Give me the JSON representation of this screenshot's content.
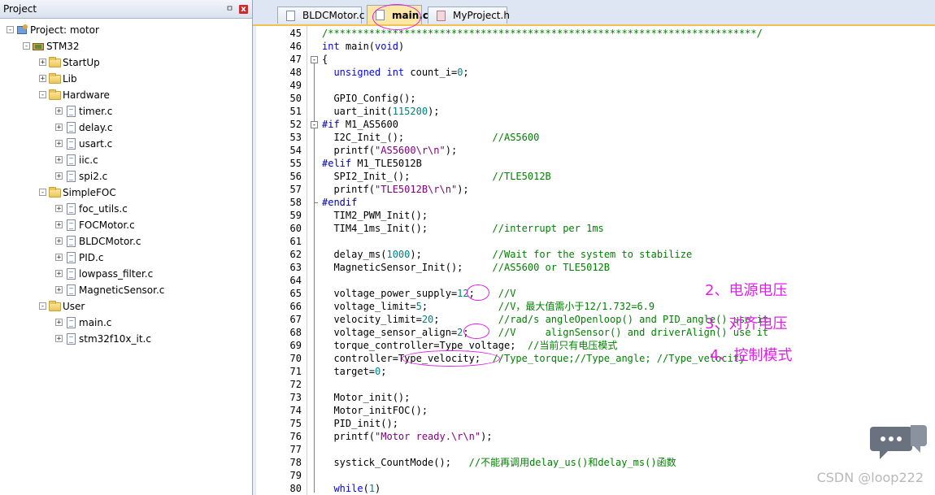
{
  "project_pane": {
    "title": "Project",
    "pin_glyph": "ㅁ",
    "close_glyph": "x",
    "tree": [
      {
        "label": "Project: motor",
        "level": 0,
        "icon": "project-icon",
        "expander": "-"
      },
      {
        "label": "STM32",
        "level": 1,
        "icon": "target-icon",
        "expander": "-"
      },
      {
        "label": "StartUp",
        "level": 2,
        "icon": "folder-icon",
        "expander": "+"
      },
      {
        "label": "Lib",
        "level": 2,
        "icon": "folder-icon",
        "expander": "+"
      },
      {
        "label": "Hardware",
        "level": 2,
        "icon": "folder-icon",
        "expander": "-"
      },
      {
        "label": "timer.c",
        "level": 3,
        "icon": "file-icon",
        "expander": "+"
      },
      {
        "label": "delay.c",
        "level": 3,
        "icon": "file-icon",
        "expander": "+"
      },
      {
        "label": "usart.c",
        "level": 3,
        "icon": "file-icon",
        "expander": "+"
      },
      {
        "label": "iic.c",
        "level": 3,
        "icon": "file-icon",
        "expander": "+"
      },
      {
        "label": "spi2.c",
        "level": 3,
        "icon": "file-icon",
        "expander": "+"
      },
      {
        "label": "SimpleFOC",
        "level": 2,
        "icon": "folder-icon",
        "expander": "-"
      },
      {
        "label": "foc_utils.c",
        "level": 3,
        "icon": "file-icon",
        "expander": "+"
      },
      {
        "label": "FOCMotor.c",
        "level": 3,
        "icon": "file-icon",
        "expander": "+"
      },
      {
        "label": "BLDCMotor.c",
        "level": 3,
        "icon": "file-icon",
        "expander": "+"
      },
      {
        "label": "PID.c",
        "level": 3,
        "icon": "file-icon",
        "expander": "+"
      },
      {
        "label": "lowpass_filter.c",
        "level": 3,
        "icon": "file-icon",
        "expander": "+"
      },
      {
        "label": "MagneticSensor.c",
        "level": 3,
        "icon": "file-icon",
        "expander": "+"
      },
      {
        "label": "User",
        "level": 2,
        "icon": "folder-icon",
        "expander": "-"
      },
      {
        "label": "main.c",
        "level": 3,
        "icon": "file-icon",
        "expander": "+"
      },
      {
        "label": "stm32f10x_it.c",
        "level": 3,
        "icon": "file-icon",
        "expander": "+"
      }
    ]
  },
  "tabs": [
    {
      "label": "BLDCMotor.c",
      "active": false,
      "kind": "c"
    },
    {
      "label": "main.c",
      "active": true,
      "kind": "c"
    },
    {
      "label": "MyProject.h",
      "active": false,
      "kind": "h"
    }
  ],
  "code_lines": [
    {
      "n": "45",
      "t": [
        [
          "cm",
          "/*************************************************************************/"
        ]
      ]
    },
    {
      "n": "46",
      "t": [
        [
          "kw",
          "int"
        ],
        [
          "",
          " main("
        ],
        [
          "kw",
          "void"
        ],
        [
          "",
          ")"
        ]
      ]
    },
    {
      "n": "47",
      "t": [
        [
          "",
          "{"
        ]
      ]
    },
    {
      "n": "48",
      "t": [
        [
          "",
          "  "
        ],
        [
          "kw",
          "unsigned int"
        ],
        [
          "",
          " count_i="
        ],
        [
          "num",
          "0"
        ],
        [
          "",
          ";"
        ]
      ]
    },
    {
      "n": "49",
      "t": []
    },
    {
      "n": "50",
      "t": [
        [
          "",
          "  GPIO_Config();"
        ]
      ]
    },
    {
      "n": "51",
      "t": [
        [
          "",
          "  uart_init("
        ],
        [
          "num",
          "115200"
        ],
        [
          "",
          ");"
        ]
      ]
    },
    {
      "n": "52",
      "t": [
        [
          "pp",
          "#if"
        ],
        [
          "",
          " M1_AS5600"
        ]
      ]
    },
    {
      "n": "53",
      "t": [
        [
          "",
          "  I2C_Init_();               "
        ],
        [
          "cm",
          "//AS5600"
        ]
      ]
    },
    {
      "n": "54",
      "t": [
        [
          "",
          "  printf("
        ],
        [
          "str",
          "\"AS5600\\r\\n\""
        ],
        [
          "",
          ");"
        ]
      ]
    },
    {
      "n": "55",
      "t": [
        [
          "pp",
          "#elif"
        ],
        [
          "",
          " M1_TLE5012B"
        ]
      ]
    },
    {
      "n": "56",
      "t": [
        [
          "",
          "  SPI2_Init_();              "
        ],
        [
          "cm",
          "//TLE5012B"
        ]
      ]
    },
    {
      "n": "57",
      "t": [
        [
          "",
          "  printf("
        ],
        [
          "str",
          "\"TLE5012B\\r\\n\""
        ],
        [
          "",
          ");"
        ]
      ]
    },
    {
      "n": "58",
      "t": [
        [
          "pp",
          "#endif"
        ]
      ]
    },
    {
      "n": "59",
      "t": [
        [
          "",
          "  TIM2_PWM_Init();"
        ]
      ]
    },
    {
      "n": "60",
      "t": [
        [
          "",
          "  TIM4_1ms_Init();           "
        ],
        [
          "cm",
          "//interrupt per 1ms"
        ]
      ]
    },
    {
      "n": "61",
      "t": []
    },
    {
      "n": "62",
      "t": [
        [
          "",
          "  delay_ms("
        ],
        [
          "num",
          "1000"
        ],
        [
          "",
          ");            "
        ],
        [
          "cm",
          "//Wait for the system to stabilize"
        ]
      ]
    },
    {
      "n": "63",
      "t": [
        [
          "",
          "  MagneticSensor_Init();     "
        ],
        [
          "cm",
          "//AS5600 or TLE5012B"
        ]
      ]
    },
    {
      "n": "64",
      "t": []
    },
    {
      "n": "65",
      "t": [
        [
          "",
          "  voltage_power_supply="
        ],
        [
          "num",
          "12"
        ],
        [
          "",
          ";    "
        ],
        [
          "cm",
          "//V"
        ]
      ]
    },
    {
      "n": "66",
      "t": [
        [
          "",
          "  voltage_limit="
        ],
        [
          "num",
          "5"
        ],
        [
          "",
          ";            "
        ],
        [
          "cm",
          "//V，最大值需小于12/1.732=6.9"
        ]
      ]
    },
    {
      "n": "67",
      "t": [
        [
          "",
          "  velocity_limit="
        ],
        [
          "num",
          "20"
        ],
        [
          "",
          ";          "
        ],
        [
          "cm",
          "//rad/s angleOpenloop() and PID_angle() use it"
        ]
      ]
    },
    {
      "n": "68",
      "t": [
        [
          "",
          "  voltage_sensor_align="
        ],
        [
          "num",
          "2"
        ],
        [
          "",
          ";     "
        ],
        [
          "cm",
          "//V     alignSensor() and driverAlign() use it"
        ]
      ]
    },
    {
      "n": "69",
      "t": [
        [
          "",
          "  torque_controller=Type_voltage;  "
        ],
        [
          "cm",
          "//当前只有电压模式"
        ]
      ]
    },
    {
      "n": "70",
      "t": [
        [
          "",
          "  controller=Type_velocity;  "
        ],
        [
          "cm",
          "//Type_torque;//Type_angle; //Type_velocity"
        ]
      ]
    },
    {
      "n": "71",
      "t": [
        [
          "",
          "  target="
        ],
        [
          "num",
          "0"
        ],
        [
          "",
          ";"
        ]
      ]
    },
    {
      "n": "72",
      "t": []
    },
    {
      "n": "73",
      "t": [
        [
          "",
          "  Motor_init();"
        ]
      ]
    },
    {
      "n": "74",
      "t": [
        [
          "",
          "  Motor_initFOC();"
        ]
      ]
    },
    {
      "n": "75",
      "t": [
        [
          "",
          "  PID_init();"
        ]
      ]
    },
    {
      "n": "76",
      "t": [
        [
          "",
          "  printf("
        ],
        [
          "str",
          "\"Motor ready.\\r\\n\""
        ],
        [
          "",
          ");"
        ]
      ]
    },
    {
      "n": "77",
      "t": []
    },
    {
      "n": "78",
      "t": [
        [
          "",
          "  systick_CountMode();   "
        ],
        [
          "cm",
          "//不能再调用delay_us()和delay_ms()函数"
        ]
      ]
    },
    {
      "n": "79",
      "t": []
    },
    {
      "n": "80",
      "t": [
        [
          "",
          "  "
        ],
        [
          "kw",
          "while"
        ],
        [
          "",
          "("
        ],
        [
          "num",
          "1"
        ],
        [
          "",
          ")"
        ]
      ]
    }
  ],
  "annotations": {
    "a2": "2、电源电压",
    "a3": "3、对齐电压",
    "a4": "4、控制模式"
  },
  "watermark": "CSDN @loop222",
  "colors": {
    "accent_tab": "#fbe7a6",
    "annotation": "#e11ee8",
    "keyword": "#0000ff",
    "comment": "#008000",
    "string": "#800080",
    "number": "#008080"
  }
}
